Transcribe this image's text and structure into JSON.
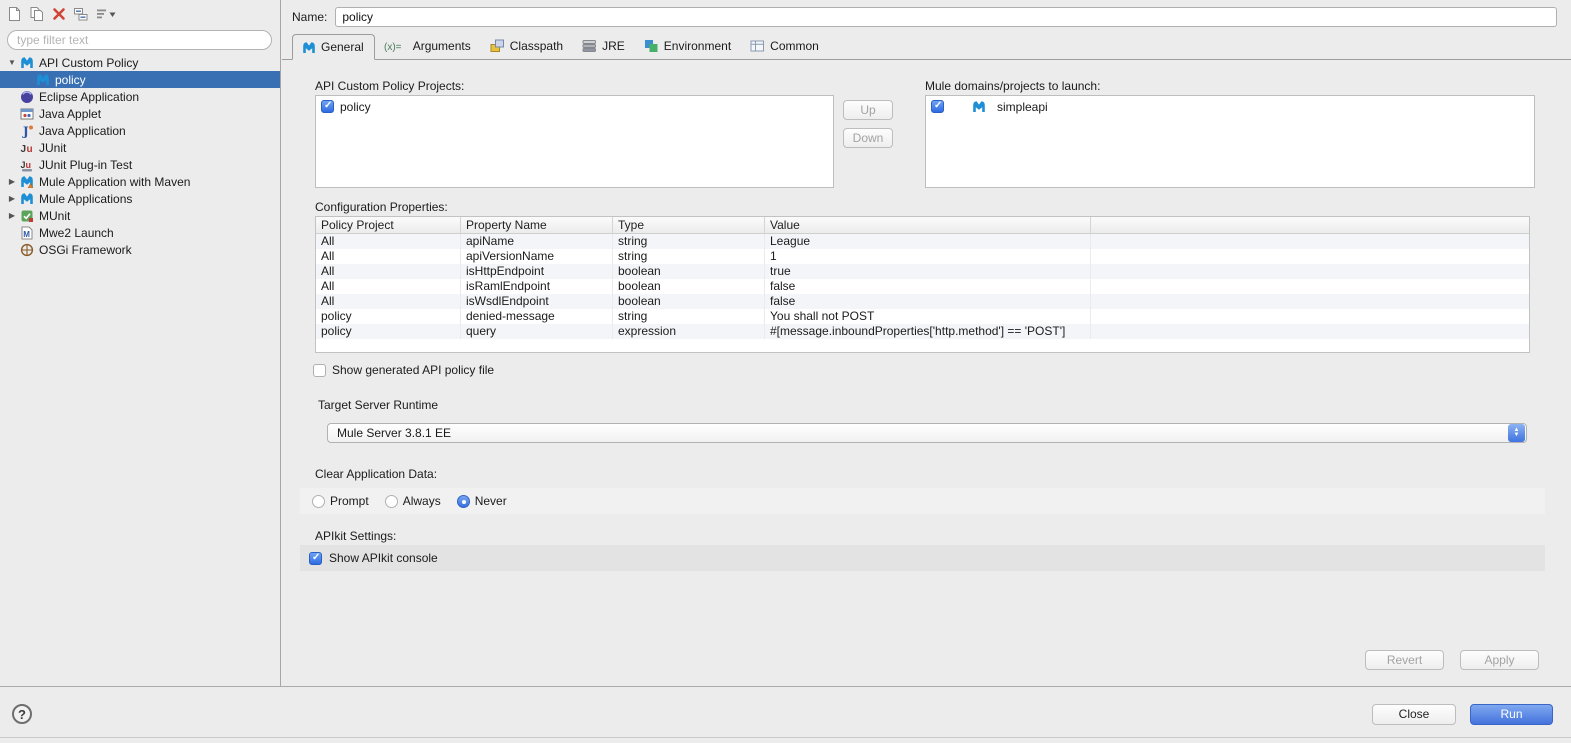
{
  "left_panel": {
    "toolbar_icons": [
      "new-config-icon",
      "duplicate-icon",
      "delete-icon",
      "collapse-all-icon",
      "filter-menu-icon"
    ],
    "filter_placeholder": "type filter text",
    "tree": [
      {
        "label": "API Custom Policy",
        "icon": "mule-icon",
        "level": 0,
        "disclosure": "expanded",
        "selected": false
      },
      {
        "label": "policy",
        "icon": "mule-icon",
        "level": 1,
        "disclosure": "none",
        "selected": true
      },
      {
        "label": "Eclipse Application",
        "icon": "eclipse-icon",
        "level": 0,
        "disclosure": "none",
        "selected": false
      },
      {
        "label": "Java Applet",
        "icon": "java-applet-icon",
        "level": 0,
        "disclosure": "none",
        "selected": false
      },
      {
        "label": "Java Application",
        "icon": "java-application-icon",
        "level": 0,
        "disclosure": "none",
        "selected": false
      },
      {
        "label": "JUnit",
        "icon": "junit-icon",
        "level": 0,
        "disclosure": "none",
        "selected": false
      },
      {
        "label": "JUnit Plug-in Test",
        "icon": "junit-plugin-icon",
        "level": 0,
        "disclosure": "none",
        "selected": false
      },
      {
        "label": "Mule Application with Maven",
        "icon": "mule-maven-icon",
        "level": 0,
        "disclosure": "collapsed",
        "selected": false
      },
      {
        "label": "Mule Applications",
        "icon": "mule-icon",
        "level": 0,
        "disclosure": "collapsed",
        "selected": false
      },
      {
        "label": "MUnit",
        "icon": "munit-icon",
        "level": 0,
        "disclosure": "collapsed",
        "selected": false
      },
      {
        "label": "Mwe2 Launch",
        "icon": "mwe2-icon",
        "level": 0,
        "disclosure": "none",
        "selected": false
      },
      {
        "label": "OSGi Framework",
        "icon": "osgi-icon",
        "level": 0,
        "disclosure": "none",
        "selected": false
      }
    ]
  },
  "header": {
    "name_label": "Name:",
    "name_value": "policy"
  },
  "tabs": [
    {
      "label": "General",
      "icon": "mule-icon",
      "active": true
    },
    {
      "label": "Arguments",
      "icon": "arguments-icon",
      "active": false
    },
    {
      "label": "Classpath",
      "icon": "classpath-icon",
      "active": false
    },
    {
      "label": "JRE",
      "icon": "jre-icon",
      "active": false
    },
    {
      "label": "Environment",
      "icon": "environment-icon",
      "active": false
    },
    {
      "label": "Common",
      "icon": "common-icon",
      "active": false
    }
  ],
  "general": {
    "projects_label": "API Custom Policy Projects:",
    "projects": [
      {
        "label": "policy",
        "checked": true
      }
    ],
    "up_label": "Up",
    "down_label": "Down",
    "domains_label": "Mule domains/projects to launch:",
    "domains": [
      {
        "label": "simpleapi",
        "checked": true,
        "icon": "mule-icon"
      }
    ],
    "config_properties_label": "Configuration Properties:",
    "table": {
      "columns": [
        "Policy Project",
        "Property Name",
        "Type",
        "Value"
      ],
      "rows": [
        [
          "All",
          "apiName",
          "string",
          "League"
        ],
        [
          "All",
          "apiVersionName",
          "string",
          "1"
        ],
        [
          "All",
          "isHttpEndpoint",
          "boolean",
          "true"
        ],
        [
          "All",
          "isRamlEndpoint",
          "boolean",
          "false"
        ],
        [
          "All",
          "isWsdlEndpoint",
          "boolean",
          "false"
        ],
        [
          "policy",
          "denied-message",
          "string",
          "You shall not POST"
        ],
        [
          "policy",
          "query",
          "expression",
          "#[message.inboundProperties['http.method'] == 'POST']"
        ]
      ]
    },
    "show_generated_label": "Show generated API policy file",
    "show_generated_checked": false,
    "target_server_label": "Target Server Runtime",
    "target_server_value": "Mule Server 3.8.1 EE",
    "clear_data_label": "Clear Application Data:",
    "clear_data_options": [
      "Prompt",
      "Always",
      "Never"
    ],
    "clear_data_selected": "Never",
    "apikit_label": "APIkit Settings:",
    "apikit_checkbox_label": "Show APIkit console",
    "apikit_checked": true
  },
  "buttons": {
    "revert": "Revert",
    "apply": "Apply",
    "close": "Close",
    "run": "Run",
    "help": "?"
  },
  "colors": {
    "selection_blue": "#3970b4",
    "checkbox_blue": "#2f6be0",
    "run_button_blue": "#4473dc",
    "mule_blue": "#1e8fd5"
  }
}
